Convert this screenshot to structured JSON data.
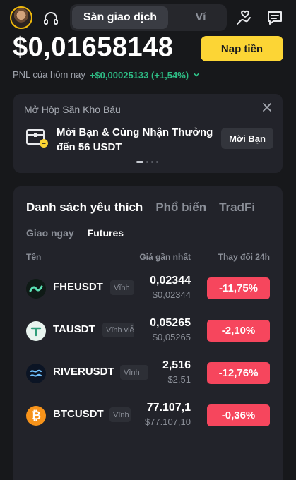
{
  "header": {
    "tabs": [
      {
        "label": "Sàn giao dịch",
        "active": true
      },
      {
        "label": "Ví",
        "active": false
      }
    ],
    "icons": [
      "avatar",
      "headset-icon",
      "hand-heart-icon",
      "chat-icon"
    ]
  },
  "balance": {
    "value": "$0,01658148",
    "deposit_label": "Nạp tiền",
    "pnl_label": "PNL của hôm nay",
    "pnl_value": "+$0,00025133 (+1,54%)"
  },
  "promo": {
    "title": "Mở Hộp Săn Kho Báu",
    "text": "Mời Bạn & Cùng Nhận Thưởng đến 56 USDT",
    "button": "Mời Bạn",
    "carousel_index": 1,
    "carousel_count": 4
  },
  "market": {
    "tabs": [
      "Danh sách yêu thích",
      "Phổ biến",
      "TradFi"
    ],
    "subtabs": [
      "Giao ngay",
      "Futures"
    ],
    "columns": {
      "name": "Tên",
      "price": "Giá gần nhất",
      "change": "Thay đổi 24h"
    },
    "rows": [
      {
        "symbol": "FHEUSDT",
        "tag": "Vĩnh",
        "price": "0,02344",
        "price_usd": "$0,02344",
        "change": "-11,75%"
      },
      {
        "symbol": "TAUSDT",
        "tag": "Vĩnh viễn",
        "price": "0,05265",
        "price_usd": "$0,05265",
        "change": "-2,10%"
      },
      {
        "symbol": "RIVERUSDT",
        "tag": "Vĩnh",
        "price": "2,516",
        "price_usd": "$2,51",
        "change": "-12,76%"
      },
      {
        "symbol": "BTCUSDT",
        "tag": "Vĩnh",
        "price": "77.107,1",
        "price_usd": "$77.107,10",
        "change": "-0,36%"
      }
    ]
  },
  "colors": {
    "background": "#17181b",
    "card": "#22232a",
    "accent_yellow": "#fcd535",
    "positive": "#2ebd85",
    "negative": "#f6465d"
  }
}
